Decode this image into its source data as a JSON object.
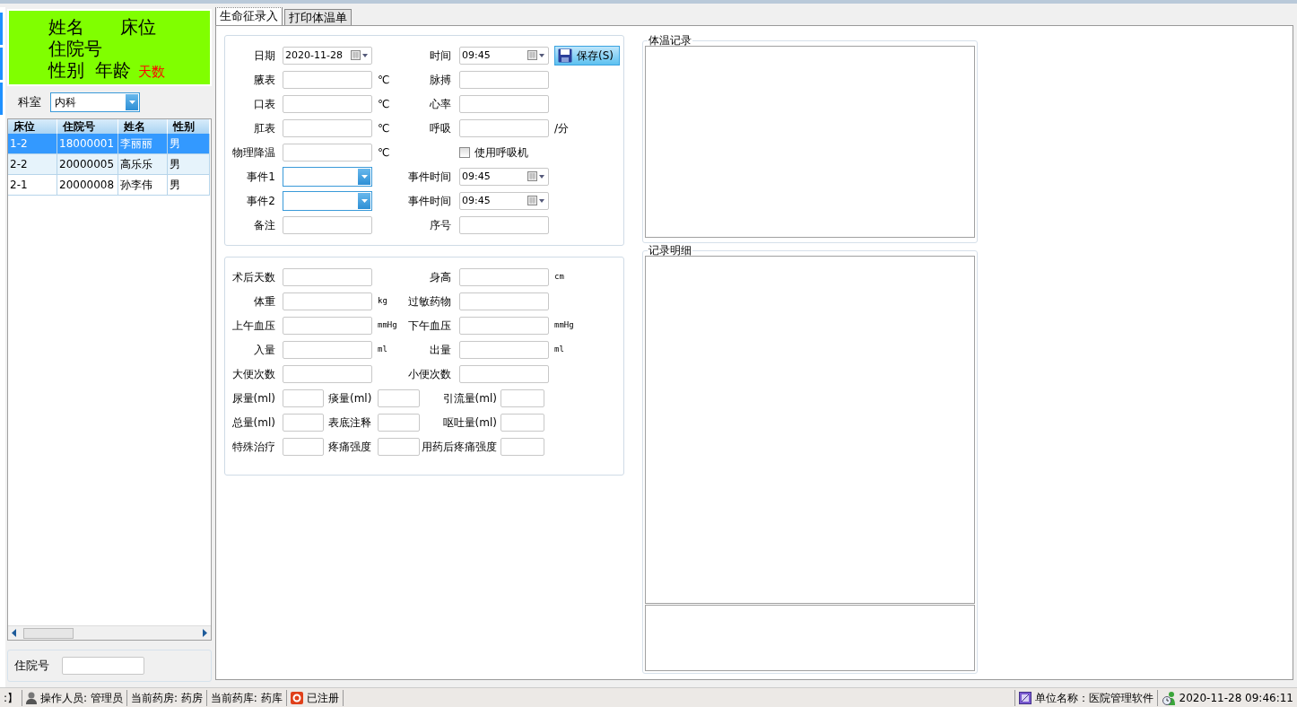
{
  "patient_card": {
    "name_label": "姓名",
    "bed_label": "床位",
    "admission_label": "住院号",
    "sex_label": "性别",
    "age_label": "年龄",
    "days_label": "天数"
  },
  "department": {
    "label": "科室",
    "value": "内科"
  },
  "patient_table": {
    "columns": [
      "床位",
      "住院号",
      "姓名",
      "性别"
    ],
    "rows": [
      {
        "cells": [
          "1-2",
          "18000001",
          "李丽丽",
          "男"
        ],
        "selected": true
      },
      {
        "cells": [
          "2-2",
          "20000005",
          "高乐乐",
          "男"
        ],
        "selected": false
      },
      {
        "cells": [
          "2-1",
          "20000008",
          "孙李伟",
          "男"
        ],
        "selected": false
      }
    ]
  },
  "admission_search": {
    "label": "住院号"
  },
  "tabs": [
    {
      "label": "生命征录入",
      "selected": true
    },
    {
      "label": "打印体温单",
      "selected": false
    }
  ],
  "vitals_form": {
    "rows": [
      {
        "kind": "wide",
        "pairs": [
          {
            "label": "日期",
            "field": {
              "kind": "date",
              "value": "2020-11-28"
            }
          },
          {
            "label": "时间",
            "field": {
              "kind": "date",
              "value": "09:45"
            }
          }
        ],
        "button": "保存(S)"
      },
      {
        "kind": "wide",
        "pairs": [
          {
            "label": "腋表",
            "field": {
              "kind": "text"
            },
            "unit": "℃"
          },
          {
            "label": "脉搏",
            "field": {
              "kind": "text"
            }
          }
        ]
      },
      {
        "kind": "wide",
        "pairs": [
          {
            "label": "口表",
            "field": {
              "kind": "text"
            },
            "unit": "℃"
          },
          {
            "label": "心率",
            "field": {
              "kind": "text"
            }
          }
        ]
      },
      {
        "kind": "wide",
        "pairs": [
          {
            "label": "肛表",
            "field": {
              "kind": "text"
            },
            "unit": "℃"
          },
          {
            "label": "呼吸",
            "field": {
              "kind": "text"
            },
            "unit": "/分"
          }
        ]
      },
      {
        "kind": "wide",
        "pairs": [
          {
            "label": "物理降温",
            "field": {
              "kind": "text"
            },
            "unit": "℃"
          },
          {
            "field": {
              "kind": "checkbox",
              "label": "使用呼吸机",
              "checked": false
            }
          }
        ]
      },
      {
        "kind": "wide",
        "pairs": [
          {
            "label": "事件1",
            "field": {
              "kind": "combo"
            }
          },
          {
            "label": "事件时间",
            "field": {
              "kind": "date",
              "value": "09:45"
            }
          }
        ]
      },
      {
        "kind": "wide",
        "pairs": [
          {
            "label": "事件2",
            "field": {
              "kind": "combo"
            }
          },
          {
            "label": "事件时间",
            "field": {
              "kind": "date",
              "value": "09:45"
            }
          }
        ]
      },
      {
        "kind": "wide",
        "pairs": [
          {
            "label": "备注",
            "field": {
              "kind": "text"
            }
          },
          {
            "label": "序号",
            "field": {
              "kind": "text"
            }
          }
        ]
      }
    ]
  },
  "measures_form": {
    "rows": [
      {
        "kind": "wide",
        "pairs": [
          {
            "label": "术后天数",
            "field": {
              "kind": "text"
            }
          },
          {
            "label": "身高",
            "field": {
              "kind": "text"
            },
            "unit": "cm"
          }
        ]
      },
      {
        "kind": "wide",
        "pairs": [
          {
            "label": "体重",
            "field": {
              "kind": "text"
            },
            "unit": "kg"
          },
          {
            "label": "过敏药物",
            "field": {
              "kind": "text"
            }
          }
        ]
      },
      {
        "kind": "wide",
        "pairs": [
          {
            "label": "上午血压",
            "field": {
              "kind": "text"
            },
            "unit": "mmHg"
          },
          {
            "label": "下午血压",
            "field": {
              "kind": "text"
            },
            "unit": "mmHg"
          }
        ]
      },
      {
        "kind": "wide",
        "pairs": [
          {
            "label": "入量",
            "field": {
              "kind": "text"
            },
            "unit": "ml"
          },
          {
            "label": "出量",
            "field": {
              "kind": "text"
            },
            "unit": "ml"
          }
        ]
      },
      {
        "kind": "wide",
        "pairs": [
          {
            "label": "大便次数",
            "field": {
              "kind": "text"
            }
          },
          {
            "label": "小便次数",
            "field": {
              "kind": "text"
            }
          }
        ]
      },
      {
        "kind": "narrow",
        "pairs": [
          {
            "label": "尿量(ml)",
            "field": {
              "kind": "text"
            }
          },
          {
            "label": "痰量(ml)",
            "field": {
              "kind": "text"
            }
          },
          {
            "label": "引流量(ml)",
            "field": {
              "kind": "text"
            }
          }
        ]
      },
      {
        "kind": "narrow",
        "pairs": [
          {
            "label": "总量(ml)",
            "field": {
              "kind": "text"
            }
          },
          {
            "label": "表底注释",
            "field": {
              "kind": "text"
            }
          },
          {
            "label": "呕吐量(ml)",
            "field": {
              "kind": "text"
            }
          }
        ]
      },
      {
        "kind": "narrow",
        "pairs": [
          {
            "label": "特殊治疗",
            "field": {
              "kind": "text"
            }
          },
          {
            "label": "疼痛强度",
            "field": {
              "kind": "text"
            }
          },
          {
            "label": "用药后疼痛强度",
            "field": {
              "kind": "text"
            }
          }
        ]
      }
    ]
  },
  "temperature_records": {
    "title": "体温记录"
  },
  "record_details": {
    "title": "记录明细"
  },
  "status_bar": {
    "left": [
      {
        "kind": "plain",
        "text": ":】"
      },
      {
        "kind": "user",
        "text": "操作人员: 管理员"
      },
      {
        "kind": "plain",
        "text": "当前药房: 药房"
      },
      {
        "kind": "plain",
        "text": "当前药库:  药库"
      },
      {
        "kind": "registered",
        "text": "已注册"
      }
    ],
    "right": [
      {
        "kind": "company",
        "text": "单位名称：医院管理软件"
      },
      {
        "kind": "clock",
        "text": "2020-11-28 09:46:11"
      }
    ]
  }
}
